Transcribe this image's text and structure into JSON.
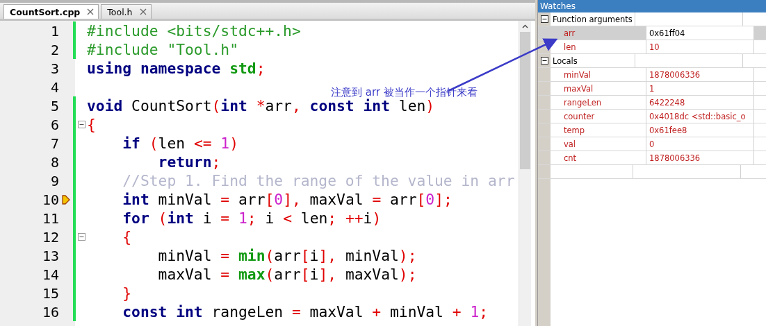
{
  "editor": {
    "tabs": [
      {
        "label": "CountSort.cpp",
        "selected": true
      },
      {
        "label": "Tool.h",
        "selected": false
      }
    ],
    "lines": [
      {
        "number": "1",
        "modified": true,
        "fold_marker": false,
        "current": false,
        "tokens": [
          {
            "kind": "preprocessor",
            "text": "#include <bits/stdc++.h>"
          }
        ]
      },
      {
        "number": "2",
        "modified": true,
        "fold_marker": false,
        "current": false,
        "tokens": [
          {
            "kind": "preprocessor",
            "text": "#include \"Tool.h\""
          }
        ]
      },
      {
        "number": "3",
        "modified": false,
        "fold_marker": false,
        "current": false,
        "tokens": [
          {
            "kind": "keyword",
            "text": "using"
          },
          {
            "kind": "keyword",
            "text": " namespace"
          },
          {
            "kind": "type",
            "text": " std"
          },
          {
            "kind": "operator",
            "text": ";"
          }
        ]
      },
      {
        "number": "4",
        "modified": false,
        "fold_marker": false,
        "current": false
      },
      {
        "number": "5",
        "modified": true,
        "fold_marker": false,
        "current": false,
        "tokens": [
          {
            "kind": "keyword",
            "text": "void"
          },
          {
            "kind": "plain",
            "text": " CountSort"
          },
          {
            "kind": "operator",
            "text": "("
          },
          {
            "kind": "keyword",
            "text": "int"
          },
          {
            "kind": "operator",
            "text": " *"
          },
          {
            "kind": "plain",
            "text": "arr"
          },
          {
            "kind": "operator",
            "text": ","
          },
          {
            "kind": "keyword",
            "text": " const"
          },
          {
            "kind": "keyword",
            "text": " int"
          },
          {
            "kind": "plain",
            "text": " len"
          },
          {
            "kind": "operator",
            "text": ")"
          }
        ]
      },
      {
        "number": "6",
        "modified": true,
        "fold_marker": true,
        "current": false,
        "tokens": [
          {
            "kind": "operator",
            "text": "{"
          }
        ]
      },
      {
        "number": "7",
        "modified": true,
        "fold_marker": false,
        "current": false,
        "tokens": [
          {
            "kind": "keyword",
            "text": "    if"
          },
          {
            "kind": "operator",
            "text": " ("
          },
          {
            "kind": "plain",
            "text": "len"
          },
          {
            "kind": "operator",
            "text": " <="
          },
          {
            "kind": "number",
            "text": " 1"
          },
          {
            "kind": "operator",
            "text": ")"
          }
        ]
      },
      {
        "number": "8",
        "modified": true,
        "fold_marker": false,
        "current": false,
        "tokens": [
          {
            "kind": "keyword",
            "text": "        return"
          },
          {
            "kind": "operator",
            "text": ";"
          }
        ]
      },
      {
        "number": "9",
        "modified": true,
        "fold_marker": false,
        "current": false,
        "tokens": [
          {
            "kind": "comment",
            "text": "    //Step 1. Find the range of the value in arr"
          }
        ]
      },
      {
        "number": "10",
        "modified": true,
        "fold_marker": false,
        "current": true,
        "tokens": [
          {
            "kind": "keyword",
            "text": "    int"
          },
          {
            "kind": "plain",
            "text": " minVal"
          },
          {
            "kind": "operator",
            "text": " ="
          },
          {
            "kind": "plain",
            "text": " arr"
          },
          {
            "kind": "operator",
            "text": "["
          },
          {
            "kind": "number",
            "text": "0"
          },
          {
            "kind": "operator",
            "text": "],"
          },
          {
            "kind": "plain",
            "text": " maxVal"
          },
          {
            "kind": "operator",
            "text": " ="
          },
          {
            "kind": "plain",
            "text": " arr"
          },
          {
            "kind": "operator",
            "text": "["
          },
          {
            "kind": "number",
            "text": "0"
          },
          {
            "kind": "operator",
            "text": "];"
          }
        ]
      },
      {
        "number": "11",
        "modified": true,
        "fold_marker": false,
        "current": false,
        "tokens": [
          {
            "kind": "keyword",
            "text": "    for"
          },
          {
            "kind": "operator",
            "text": " ("
          },
          {
            "kind": "keyword",
            "text": "int"
          },
          {
            "kind": "plain",
            "text": " i"
          },
          {
            "kind": "operator",
            "text": " ="
          },
          {
            "kind": "number",
            "text": " 1"
          },
          {
            "kind": "operator",
            "text": ";"
          },
          {
            "kind": "plain",
            "text": " i"
          },
          {
            "kind": "operator",
            "text": " <"
          },
          {
            "kind": "plain",
            "text": " len"
          },
          {
            "kind": "operator",
            "text": "; ++"
          },
          {
            "kind": "plain",
            "text": "i"
          },
          {
            "kind": "operator",
            "text": ")"
          }
        ]
      },
      {
        "number": "12",
        "modified": true,
        "fold_marker": true,
        "current": false,
        "tokens": [
          {
            "kind": "operator",
            "text": "    {"
          }
        ]
      },
      {
        "number": "13",
        "modified": true,
        "fold_marker": false,
        "current": false,
        "tokens": [
          {
            "kind": "plain",
            "text": "        minVal"
          },
          {
            "kind": "operator",
            "text": " ="
          },
          {
            "kind": "function",
            "text": " min"
          },
          {
            "kind": "operator",
            "text": "("
          },
          {
            "kind": "plain",
            "text": "arr"
          },
          {
            "kind": "operator",
            "text": "["
          },
          {
            "kind": "plain",
            "text": "i"
          },
          {
            "kind": "operator",
            "text": "],"
          },
          {
            "kind": "plain",
            "text": " minVal"
          },
          {
            "kind": "operator",
            "text": ");"
          }
        ]
      },
      {
        "number": "14",
        "modified": true,
        "fold_marker": false,
        "current": false,
        "tokens": [
          {
            "kind": "plain",
            "text": "        maxVal"
          },
          {
            "kind": "operator",
            "text": " ="
          },
          {
            "kind": "function",
            "text": " max"
          },
          {
            "kind": "operator",
            "text": "("
          },
          {
            "kind": "plain",
            "text": "arr"
          },
          {
            "kind": "operator",
            "text": "["
          },
          {
            "kind": "plain",
            "text": "i"
          },
          {
            "kind": "operator",
            "text": "],"
          },
          {
            "kind": "plain",
            "text": " maxVal"
          },
          {
            "kind": "operator",
            "text": ");"
          }
        ]
      },
      {
        "number": "15",
        "modified": true,
        "fold_marker": false,
        "current": false,
        "tokens": [
          {
            "kind": "operator",
            "text": "    }"
          }
        ]
      },
      {
        "number": "16",
        "modified": true,
        "fold_marker": false,
        "current": false,
        "tokens": [
          {
            "kind": "keyword",
            "text": "    const"
          },
          {
            "kind": "keyword",
            "text": " int"
          },
          {
            "kind": "plain",
            "text": " rangeLen"
          },
          {
            "kind": "operator",
            "text": " ="
          },
          {
            "kind": "plain",
            "text": " maxVal"
          },
          {
            "kind": "operator",
            "text": " +"
          },
          {
            "kind": "plain",
            "text": " minVal"
          },
          {
            "kind": "operator",
            "text": " +"
          },
          {
            "kind": "number",
            "text": " 1"
          },
          {
            "kind": "operator",
            "text": ";"
          }
        ]
      }
    ]
  },
  "annotation": {
    "text": "注意到 arr 被当作一个指针来看"
  },
  "watches": {
    "title": "Watches",
    "groups": [
      {
        "label": "Function arguments",
        "expanded": true,
        "items": [
          {
            "name": "arr",
            "value": "0x61ff04",
            "selected": true
          },
          {
            "name": "len",
            "value": "10",
            "selected": false
          }
        ]
      },
      {
        "label": "Locals",
        "expanded": true,
        "items": [
          {
            "name": "minVal",
            "value": "1878006336",
            "selected": false
          },
          {
            "name": "maxVal",
            "value": "1",
            "selected": false
          },
          {
            "name": "rangeLen",
            "value": "6422248",
            "selected": false
          },
          {
            "name": "counter",
            "value": "0x4018dc <std::basic_o",
            "selected": false
          },
          {
            "name": "temp",
            "value": "0x61fee8",
            "selected": false
          },
          {
            "name": "val",
            "value": "0",
            "selected": false
          },
          {
            "name": "cnt",
            "value": "1878006336",
            "selected": false
          }
        ]
      }
    ]
  }
}
